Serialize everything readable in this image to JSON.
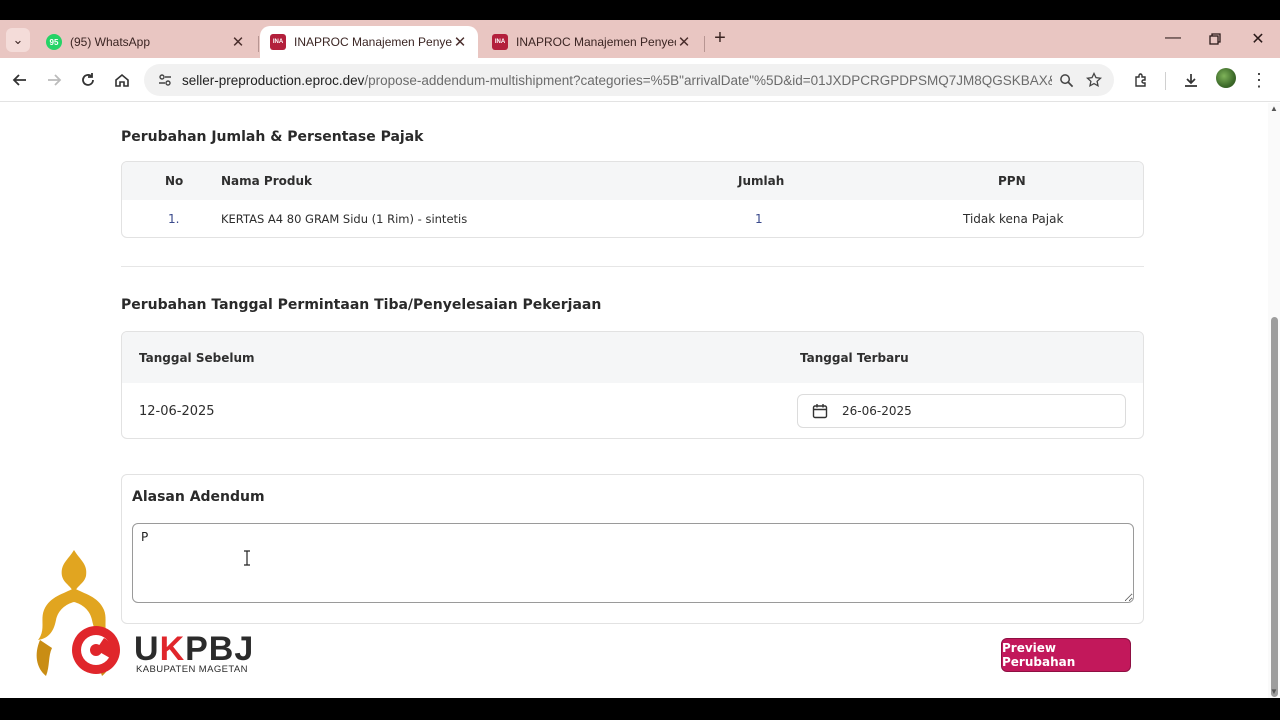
{
  "browser": {
    "tabs": [
      {
        "title": "(95) WhatsApp",
        "favicon": "whatsapp-icon",
        "favicon_text": "95",
        "active": false
      },
      {
        "title": "INAPROC Manajemen Penyedia",
        "favicon": "inaproc-icon",
        "favicon_text": "INA",
        "active": true
      },
      {
        "title": "INAPROC Manajemen Penyedia",
        "favicon": "inaproc-icon",
        "favicon_text": "INA",
        "active": false
      }
    ],
    "url_host": "seller-preproduction.eproc.dev",
    "url_path": "/propose-addendum-multishipment?categories=%5B\"arrivalDate\"%5D&id=01JXDPCRGPDPSMQ7JM8QGSKBAX&ke..."
  },
  "tax_section": {
    "title": "Perubahan Jumlah & Persentase Pajak",
    "headers": {
      "no": "No",
      "product": "Nama Produk",
      "qty": "Jumlah",
      "ppn": "PPN"
    },
    "rows": [
      {
        "no": "1.",
        "product": "KERTAS A4 80 GRAM Sidu (1 Rim) - sintetis",
        "qty": "1",
        "ppn": "Tidak kena Pajak"
      }
    ]
  },
  "date_section": {
    "title": "Perubahan Tanggal Permintaan Tiba/Penyelesaian Pekerjaan",
    "header_before": "Tanggal Sebelum",
    "header_after": "Tanggal Terbaru",
    "before_value": "12-06-2025",
    "after_value": "26-06-2025"
  },
  "reason_section": {
    "title": "Alasan Adendum",
    "value": "P"
  },
  "actions": {
    "preview_label": "Preview Perubahan"
  },
  "watermark": {
    "name_prefix": "U",
    "name_k": "K",
    "name_suffix": "PBJ",
    "subtitle": "KABUPATEN MAGETAN"
  },
  "colors": {
    "accent": "#c2185b",
    "tab_strip": "#e9c6c2"
  }
}
